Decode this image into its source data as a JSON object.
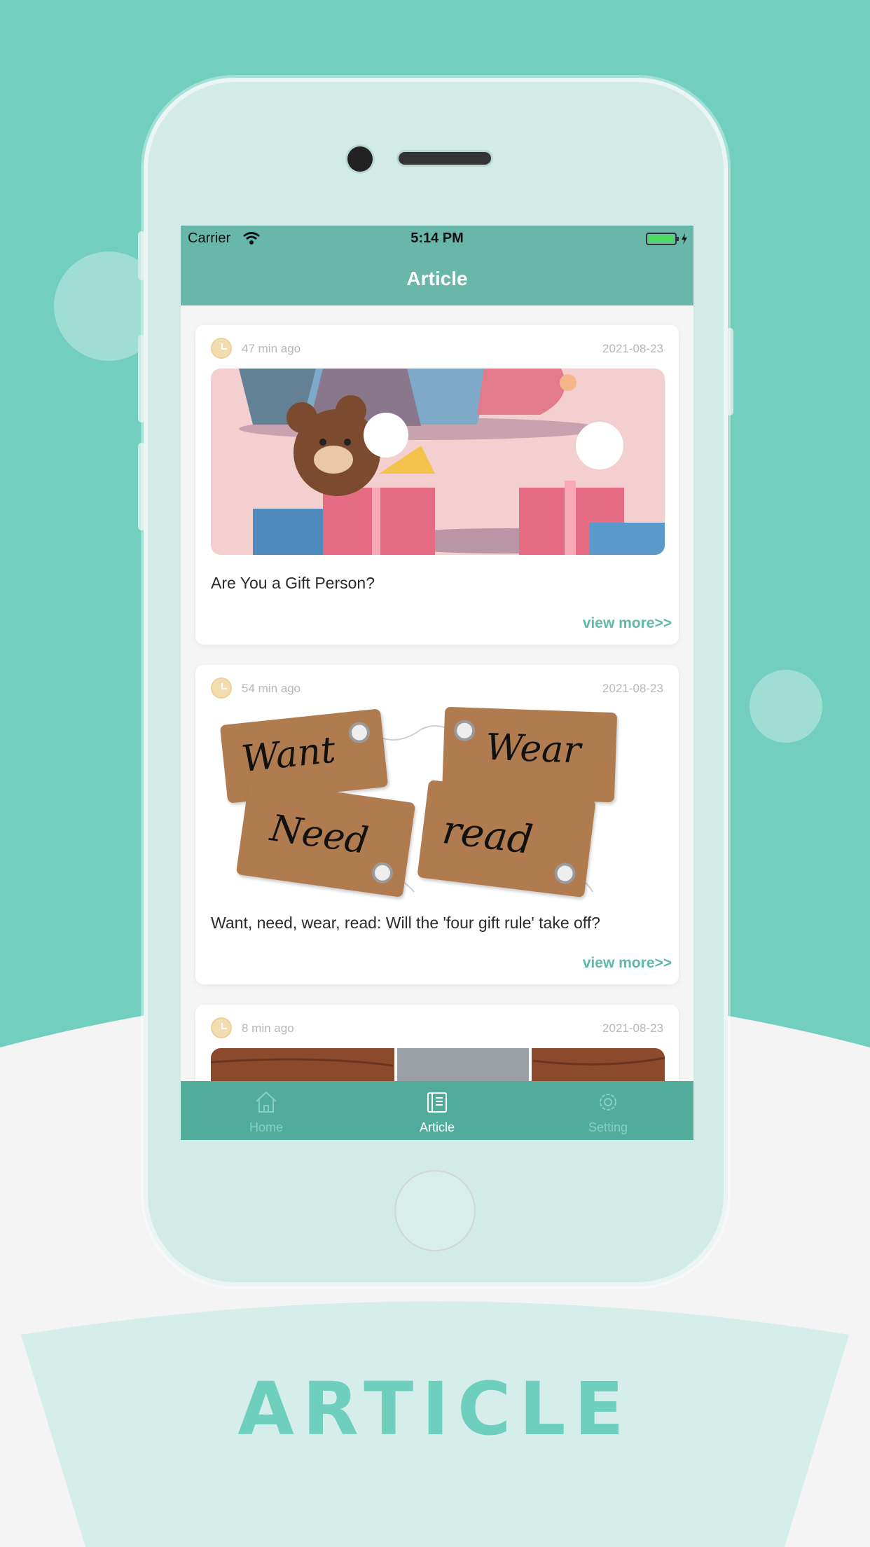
{
  "colors": {
    "teal_bg": "#72cfc0",
    "header": "#68b7a8",
    "tabbar": "#52ac9c",
    "accent": "#5fb9a8"
  },
  "status_bar": {
    "carrier": "Carrier",
    "time": "5:14 PM"
  },
  "nav": {
    "title": "Article"
  },
  "articles": [
    {
      "ago": "47 min ago",
      "date": "2021-08-23",
      "title": "Are You a Gift Person?",
      "more": "view more>>"
    },
    {
      "ago": "54 min ago",
      "date": "2021-08-23",
      "title": "Want, need, wear, read: Will the 'four gift rule' take off?",
      "more": "view more>>",
      "tags": [
        "Want",
        "Wear",
        "Need",
        "read"
      ]
    },
    {
      "ago": "8 min ago",
      "date": "2021-08-23"
    }
  ],
  "tabs": [
    {
      "label": "Home",
      "icon": "home-icon"
    },
    {
      "label": "Article",
      "icon": "book-icon"
    },
    {
      "label": "Setting",
      "icon": "gear-icon"
    }
  ],
  "footer": {
    "title": "ARTICLE"
  }
}
